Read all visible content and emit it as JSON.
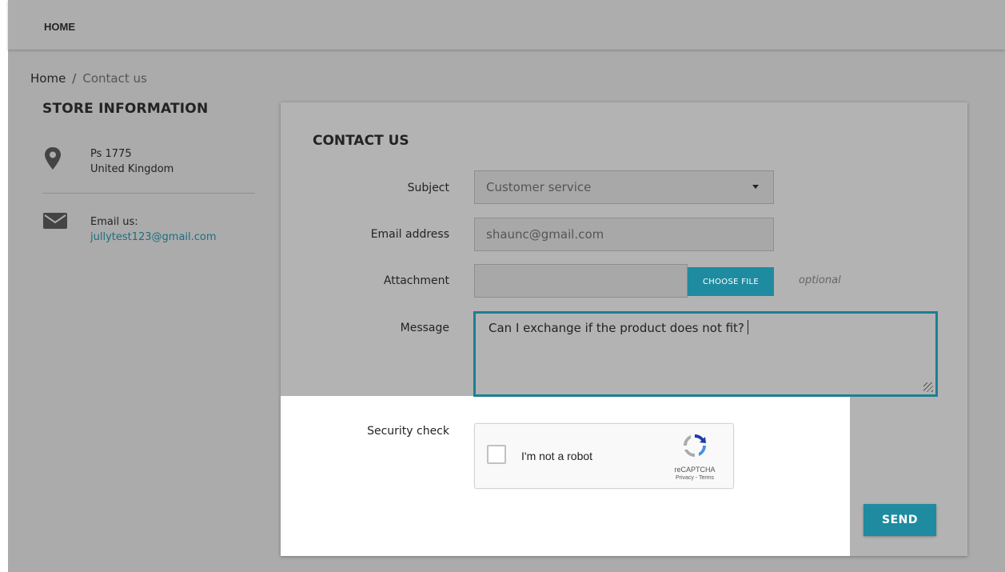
{
  "nav": {
    "home_label": "HOME"
  },
  "breadcrumb": {
    "home": "Home",
    "separator": "/",
    "current": "Contact us"
  },
  "store": {
    "title": "STORE INFORMATION",
    "address_line1": "Ps 1775",
    "address_line2": "United Kingdom",
    "email_label": "Email us:",
    "email": "jullytest123@gmail.com",
    "icons": {
      "address": "location-pin-icon",
      "email": "envelope-icon"
    }
  },
  "form": {
    "title": "CONTACT US",
    "subject_label": "Subject",
    "subject_value": "Customer service",
    "email_label": "Email address",
    "email_value": "shaunc@gmail.com",
    "attachment_label": "Attachment",
    "choose_file_label": "CHOOSE FILE",
    "optional_label": "optional",
    "message_label": "Message",
    "message_value": "Can I exchange if the product does not fit?",
    "security_label": "Security check",
    "send_label": "SEND"
  },
  "recaptcha": {
    "label": "I'm not a robot",
    "brand": "reCAPTCHA",
    "links": "Privacy - Terms"
  },
  "colors": {
    "accent": "#1f8ba0",
    "link": "#1b6f80",
    "overlay_gray": "#ababab",
    "highlight": "#ffffff"
  }
}
